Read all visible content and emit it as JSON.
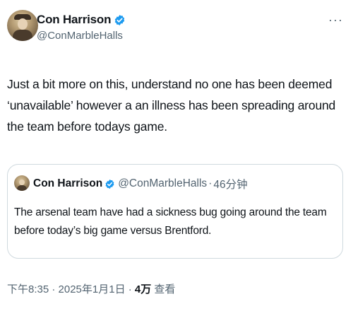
{
  "tweet": {
    "author": {
      "display_name": "Con Harrison",
      "handle": "@ConMarbleHalls",
      "verified_icon": "verified-badge-icon"
    },
    "more_label": "···",
    "text": "Just a bit more on this, understand no one has been deemed ‘unavailable’ however a an illness has been spreading around the team before todays game."
  },
  "quote": {
    "display_name": "Con Harrison",
    "handle": "@ConMarbleHalls",
    "separator": "·",
    "time": "46分钟",
    "text": "The arsenal team have had a sickness bug going around the team before today’s big game versus Brentford."
  },
  "meta": {
    "timestamp": "下午8:35 · 2025年1月1日 · ",
    "views_count": "4万",
    "views_label": " 查看"
  },
  "colors": {
    "verified": "#1d9bf0",
    "secondary_text": "#536471",
    "border": "#cfd9de"
  }
}
